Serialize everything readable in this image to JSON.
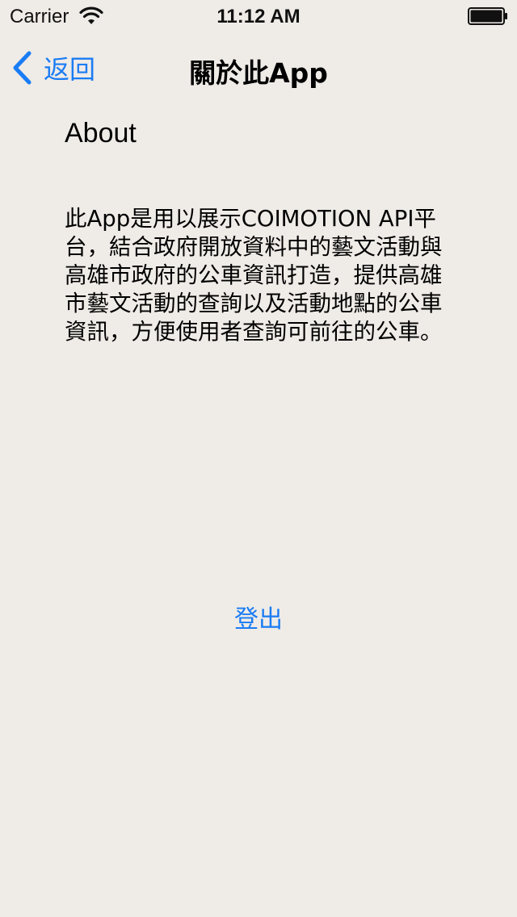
{
  "status_bar": {
    "carrier": "Carrier",
    "time": "11:12 AM",
    "wifi_icon": "wifi-icon",
    "battery_icon": "battery-icon"
  },
  "nav": {
    "back_label": "返回",
    "back_icon": "chevron-left-icon",
    "title": "關於此App"
  },
  "content": {
    "heading": "About",
    "body": "此App是用以展示COIMOTION API平台，結合政府開放資料中的藝文活動與高雄市政府的公車資訊打造，提供高雄市藝文活動的查詢以及活動地點的公車資訊，方便使用者查詢可前往的公車。"
  },
  "actions": {
    "logout_label": "登出"
  },
  "colors": {
    "background": "#efebe7",
    "accent": "#1a7cf4",
    "text": "#000000"
  }
}
